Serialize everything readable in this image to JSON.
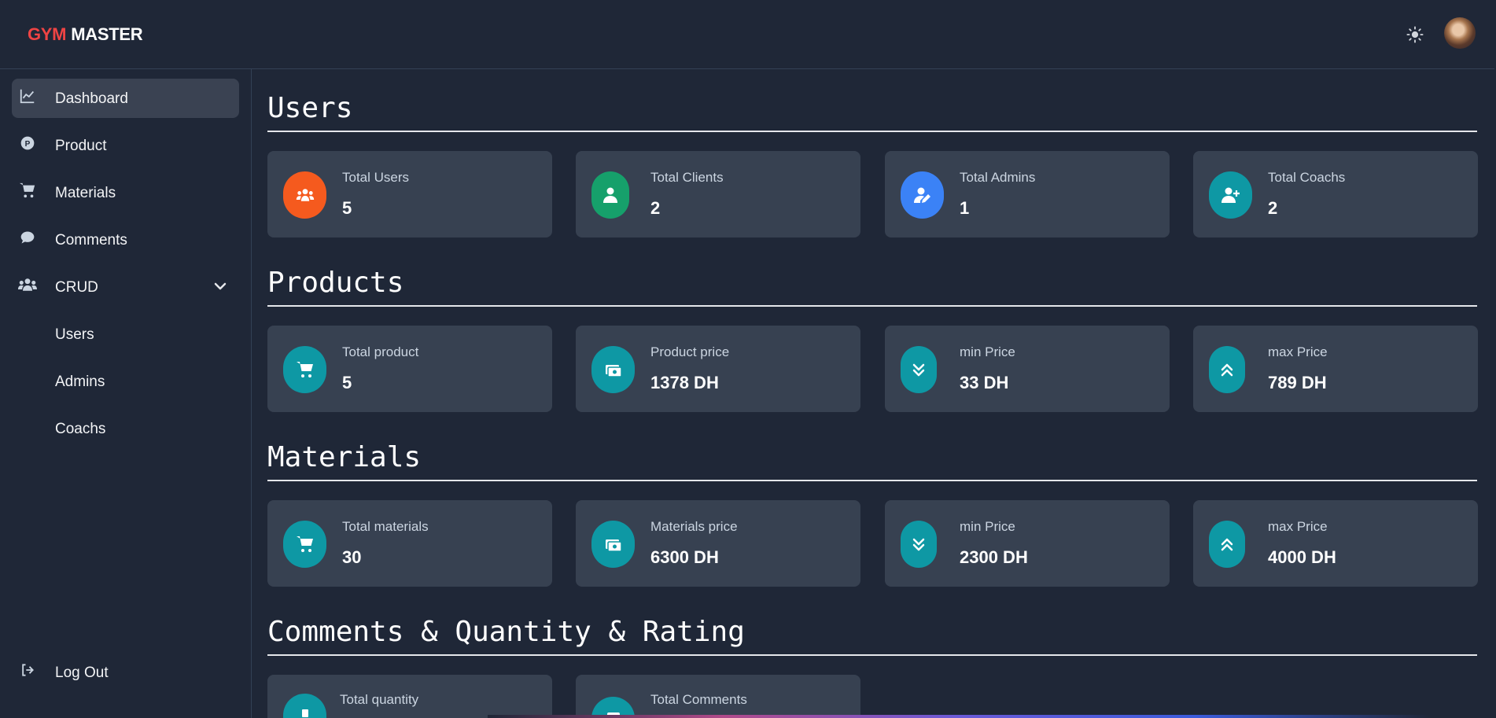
{
  "header": {
    "logo_gym": "GYM",
    "logo_master": "MASTER",
    "theme_icon": "sun-icon"
  },
  "sidebar": {
    "items": [
      {
        "label": "Dashboard",
        "icon": "chart-line-icon"
      },
      {
        "label": "Product",
        "icon": "product-p-icon"
      },
      {
        "label": "Materials",
        "icon": "cart-icon"
      },
      {
        "label": "Comments",
        "icon": "comment-icon"
      },
      {
        "label": "CRUD",
        "icon": "users-group-icon"
      }
    ],
    "crud_subitems": [
      "Users",
      "Admins",
      "Coachs"
    ],
    "logout": "Log Out"
  },
  "sections": {
    "users": {
      "title": "Users",
      "cards": [
        {
          "label": "Total Users",
          "value": "5",
          "color": "#f55a1e",
          "icon": "users-icon"
        },
        {
          "label": "Total Clients",
          "value": "2",
          "color": "#16a06b",
          "icon": "user-icon"
        },
        {
          "label": "Total Admins",
          "value": "1",
          "color": "#3b82f6",
          "icon": "user-edit-icon"
        },
        {
          "label": "Total Coachs",
          "value": "2",
          "color": "#0e98a4",
          "icon": "user-plus-icon"
        }
      ]
    },
    "products": {
      "title": "Products",
      "cards": [
        {
          "label": "Total product",
          "value": "5",
          "color": "#0e98a4",
          "icon": "cart-icon"
        },
        {
          "label": "Product price",
          "value": "1378 DH",
          "color": "#0e98a4",
          "icon": "money-icon"
        },
        {
          "label": "min Price",
          "value": "33 DH",
          "color": "#0e98a4",
          "icon": "chevrons-down-icon"
        },
        {
          "label": "max Price",
          "value": "789 DH",
          "color": "#0e98a4",
          "icon": "chevrons-up-icon"
        }
      ]
    },
    "materials": {
      "title": "Materials",
      "cards": [
        {
          "label": "Total materials",
          "value": "30",
          "color": "#0e98a4",
          "icon": "cart-icon"
        },
        {
          "label": "Materials price",
          "value": "6300 DH",
          "color": "#0e98a4",
          "icon": "money-icon"
        },
        {
          "label": "min Price",
          "value": "2300 DH",
          "color": "#0e98a4",
          "icon": "chevrons-down-icon"
        },
        {
          "label": "max Price",
          "value": "4000 DH",
          "color": "#0e98a4",
          "icon": "chevrons-up-icon"
        }
      ]
    },
    "comments": {
      "title": "Comments & Quantity & Rating",
      "cards": [
        {
          "label": "Total quantity",
          "value": "",
          "color": "#0e98a4",
          "icon": "box-icon"
        },
        {
          "label": "Total Comments",
          "value": "",
          "color": "#0e98a4",
          "icon": "comment-icon"
        }
      ]
    }
  }
}
